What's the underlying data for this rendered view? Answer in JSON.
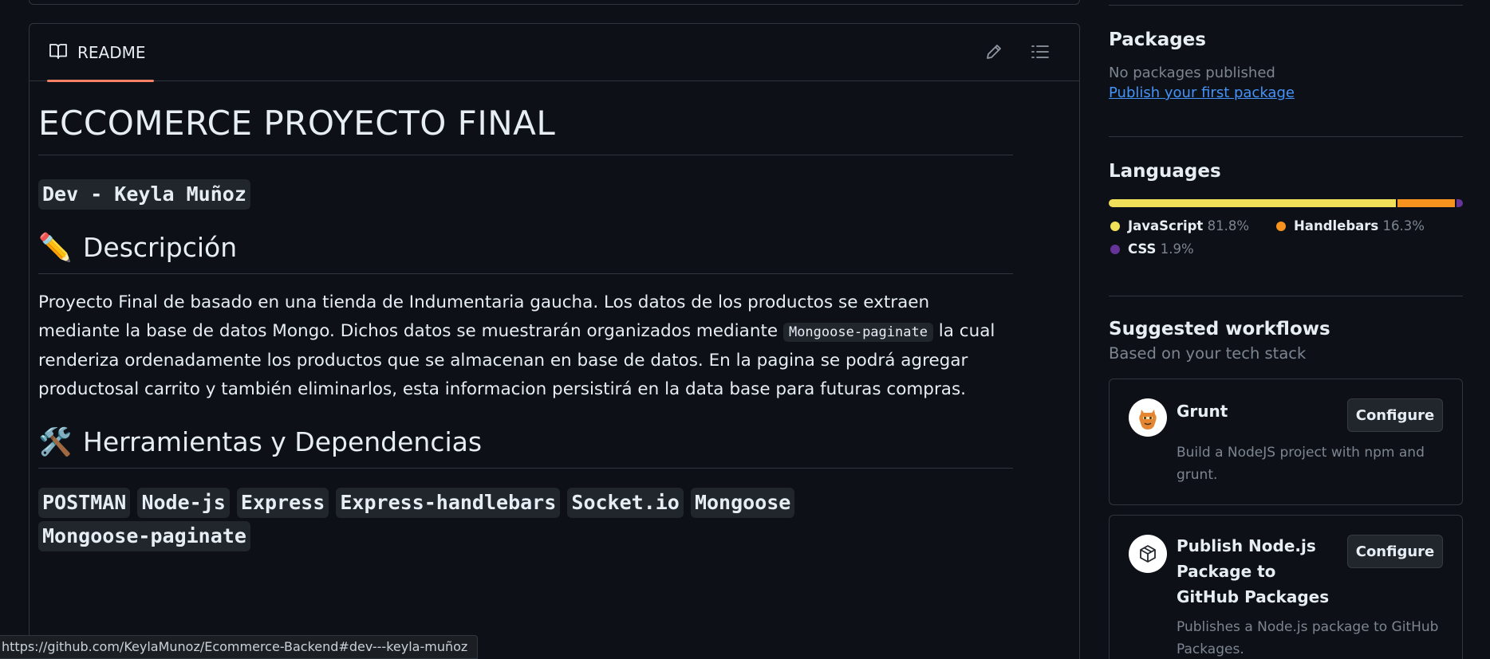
{
  "readme": {
    "tab_label": "README",
    "title": "ECCOMERCE PROYECTO FINAL",
    "dev_line": "Dev - Keyla Muñoz",
    "section_description": {
      "emoji": "✏️",
      "heading": "Descripción",
      "text_before": "Proyecto Final de basado en una tienda de Indumentaria gaucha. Los datos de los productos se extraen mediante la base de datos Mongo. Dichos datos se muestrarán organizados mediante ",
      "inline_code": "Mongoose-paginate",
      "text_after": " la cual renderiza ordenadamente los productos que se almacenan en base de datos. En la pagina se podrá agregar productosal carrito y también eliminarlos, esta informacion persistirá en la data base para futuras compras."
    },
    "section_tools": {
      "emoji": "🛠️",
      "heading": "Herramientas y Dependencias",
      "tags": [
        "POSTMAN",
        "Node-js",
        "Express",
        "Express-handlebars",
        "Socket.io",
        "Mongoose",
        "Mongoose-paginate"
      ]
    }
  },
  "sidebar": {
    "packages": {
      "title": "Packages",
      "empty_text": "No packages published",
      "link": "Publish your first package"
    },
    "languages": {
      "title": "Languages",
      "items": [
        {
          "name": "JavaScript",
          "percent": "81.8%",
          "value": 81.8,
          "color": "#f1e05a"
        },
        {
          "name": "Handlebars",
          "percent": "16.3%",
          "value": 16.3,
          "color": "#f7931e"
        },
        {
          "name": "CSS",
          "percent": "1.9%",
          "value": 1.9,
          "color": "#663399"
        }
      ]
    },
    "workflows": {
      "title": "Suggested workflows",
      "subtitle": "Based on your tech stack",
      "items": [
        {
          "name": "Grunt",
          "description": "Build a NodeJS project with npm and grunt.",
          "button": "Configure",
          "icon": "grunt-logo-icon"
        },
        {
          "name": "Publish Node.js Package to GitHub Packages",
          "description": "Publishes a Node.js package to GitHub Packages.",
          "button": "Configure",
          "icon": "package-icon"
        }
      ]
    }
  },
  "status_bar": {
    "url": "https://github.com/KeylaMunoz/Ecommerce-Backend#dev---keyla-muñoz"
  }
}
